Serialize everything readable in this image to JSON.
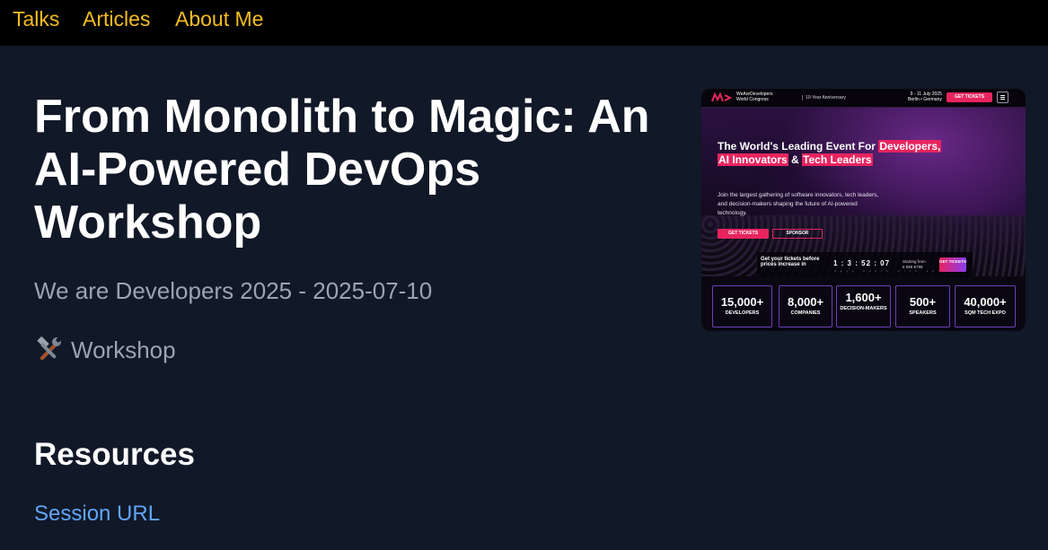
{
  "nav": {
    "items": [
      {
        "label": "Talks"
      },
      {
        "label": "Articles"
      },
      {
        "label": "About Me"
      }
    ]
  },
  "talk": {
    "title": "From Monolith to Magic: An AI-Powered DevOps Workshop",
    "event_line": "We are Developers 2025 - 2025-07-10",
    "type_icon": "tools-icon",
    "type_label": "Workshop"
  },
  "resources": {
    "heading": "Resources",
    "session_link": "Session URL"
  },
  "thumbnail": {
    "brand_line1": "WeAreDevelopers",
    "brand_line2": "World Congress",
    "anniversary": "10-Year Anniversary",
    "date_line1": "9 - 11 July 2025",
    "date_line2": "Berlin • Germany",
    "header_button": "GET TICKETS",
    "hero_title_part1": "The World's Leading Event For ",
    "hero_title_hl1": "Developers,",
    "hero_title_hl2": "AI Innovators",
    "hero_title_amp": " & ",
    "hero_title_hl3": "Tech Leaders",
    "hero_desc": "Join the largest gathering of software innovators, tech leaders, and decision-makers shaping the future of AI-powered technology.",
    "btn_tickets": "GET TICKETS",
    "btn_sponsor": "SPONSOR",
    "countdown_label": "Get your tickets before prices increase in",
    "countdown_timer": "1 : 3 : 52 : 07",
    "countdown_units": "days hours mins secs",
    "price_line1": "Starting from",
    "price_line2": "€ 599 €799",
    "countdown_button": "GET TICKETS",
    "stats": [
      {
        "value": "15,000+",
        "label": "DEVELOPERS"
      },
      {
        "value": "8,000+",
        "label": "COMPANIES"
      },
      {
        "value": "1,600+",
        "label": "DECISION-MAKERS"
      },
      {
        "value": "500+",
        "label": "SPEAKERS"
      },
      {
        "value": "40,000+",
        "label": "SQM TECH EXPO"
      }
    ]
  },
  "colors": {
    "background": "#111827",
    "nav_link": "#f5bd1f",
    "link": "#60a5fa",
    "muted_text": "#9ca3af",
    "accent_pink": "#e8245f"
  }
}
